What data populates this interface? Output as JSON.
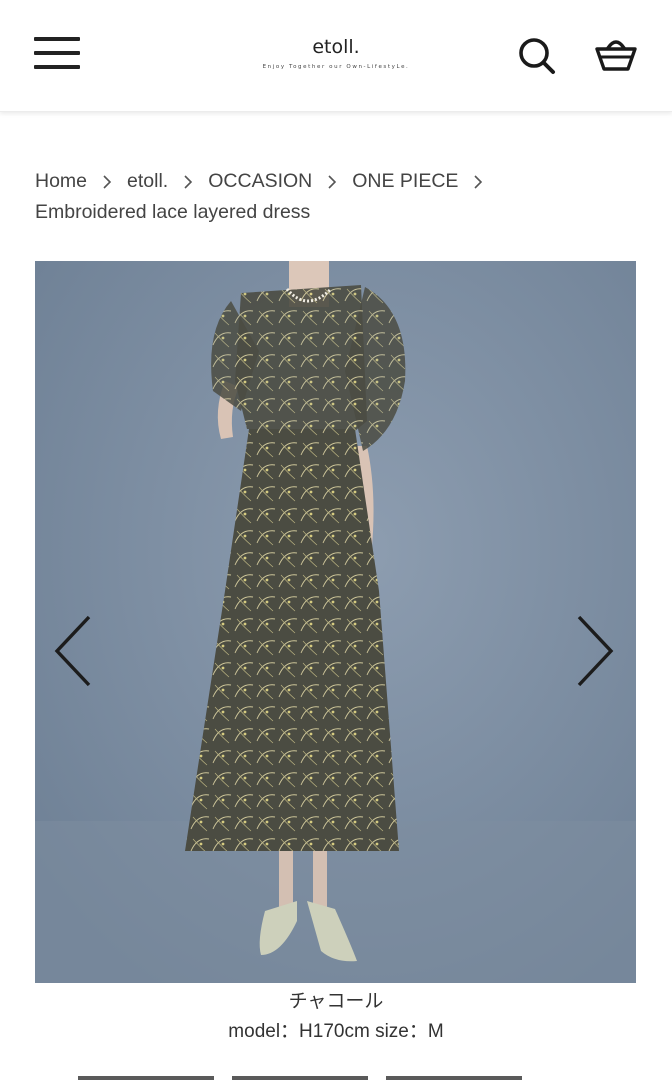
{
  "header": {
    "logo_name": "etoll.",
    "logo_tagline": "Enjoy Together our Own-LifestyLe.",
    "menu_icon": "hamburger-menu-icon",
    "search_icon": "search-icon",
    "cart_icon": "shopping-basket-icon"
  },
  "breadcrumb": {
    "items": [
      "Home",
      "etoll.",
      "OCCASION",
      "ONE PIECE"
    ],
    "current": "Embroidered lace layered dress",
    "separator_icon": "chevron-right-icon"
  },
  "gallery": {
    "image_alt": "",
    "prev_icon": "chevron-left-icon",
    "next_icon": "chevron-right-icon",
    "background_color": "#7e8fa3",
    "dress_color": "#4a4a40"
  },
  "caption": {
    "color_name": "チャコール",
    "model_info": "model：H170cm size：M"
  }
}
